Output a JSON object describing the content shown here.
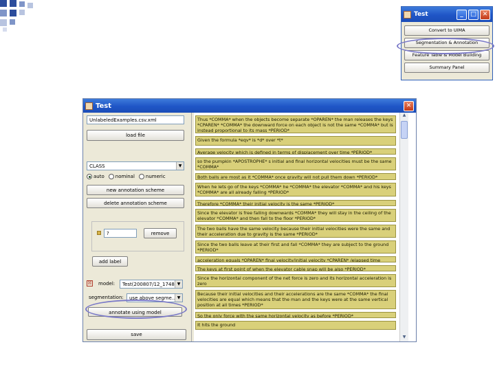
{
  "colors": {
    "titlebar": "#1f55c6",
    "highlight": "#d9d07a",
    "oval": "#7a79c8",
    "deco": "#2c4d9c"
  },
  "small_window": {
    "title": "Test",
    "buttons": [
      "Convert to UIMA",
      "Segmentation & Annotation",
      "Feature Table & Model Building",
      "Summary Panel"
    ]
  },
  "main_window": {
    "title": "Test",
    "left": {
      "file_field": "UnlabeledExamples.csv.xml",
      "load_button": "load file",
      "scheme_select": "CLASS",
      "radio_options": [
        "auto",
        "nominal",
        "numeric"
      ],
      "new_scheme_button": "new annotation scheme",
      "delete_scheme_button": "delete annotation scheme",
      "label_value": "?",
      "remove_button": "remove",
      "add_label_button": "add label",
      "model_label": "model:",
      "model_value": "Test(200807/12_1748...",
      "segmentation_label": "segmentation:",
      "segmentation_value": "use above segme...",
      "annotate_button": "annotate using model",
      "save_button": "save"
    },
    "sentences": [
      "Thus *COMMA* when the objects become separate *OPAREN* the man releases the keys *CPAREN* *COMMA* the downward force on each object is not the same *COMMA* but is instead proportional to its mass *PERIOD*",
      "Given the formula *eqv* is *d* over *t*",
      "Average velocity which is defined in terms of displacement over time *PERIOD*",
      "so the pumpkin *APOSTROPHE* s initial and final horizontal velocities must be the same *COMMA*",
      "Both balls are most as it *COMMA* once gravity will not pull them down *PERIOD*",
      "When he lets go of the keys *COMMA* he *COMMA* the elevator *COMMA* and his keys *COMMA* are all already falling *PERIOD*",
      "Therefore *COMMA* their initial velocity is the same *PERIOD*",
      "Since the elevator is free falling downwards *COMMA* they will stay in the ceiling of the elevator *COMMA* and then fall to the floor *PERIOD*",
      "The two balls have the same velocity because their initial velocities were the same and their acceleration due to gravity is the same *PERIOD*",
      "Since the two balls leave at their first and fall *COMMA* they are subject to the ground *PERIOD*",
      "acceleration equals *OPAREN* final velocity/initial velocity *CPAREN* /elapsed time",
      "The keys at first point of when the elevator cable snap will be also *PERIOD*",
      "Since the horizontal component of the net force is zero and its horizontal acceleration is zero",
      "Because their initial velocities and their accelerations are the same *COMMA* the final velocities are equal which means that the man and the keys were at the same vertical position at all times *PERIOD*",
      "So the only force with the same horizontal velocity as before *PERIOD*",
      "It hits the ground"
    ]
  }
}
